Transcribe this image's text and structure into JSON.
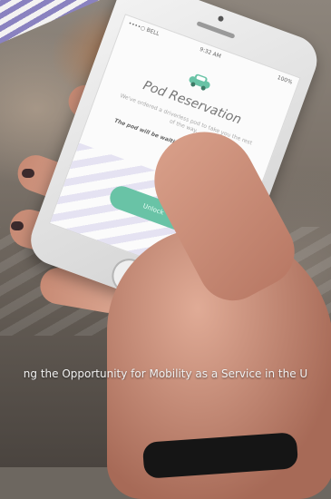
{
  "caption": "ng the Opportunity for Mobility as a Service in the U",
  "phone_screen": {
    "carrier": "••••○ BELL",
    "time": "9:32 AM",
    "battery": "100%",
    "icon": "car-icon",
    "title": "Pod Reservation",
    "description": "We've ordered a driverless pod to take you the rest of the way.",
    "note": "The pod will be waiting outside the station.",
    "button_label": "Unlock"
  },
  "colors": {
    "accent_purple": "#8a82c8",
    "button_green": "#69c3a6"
  }
}
